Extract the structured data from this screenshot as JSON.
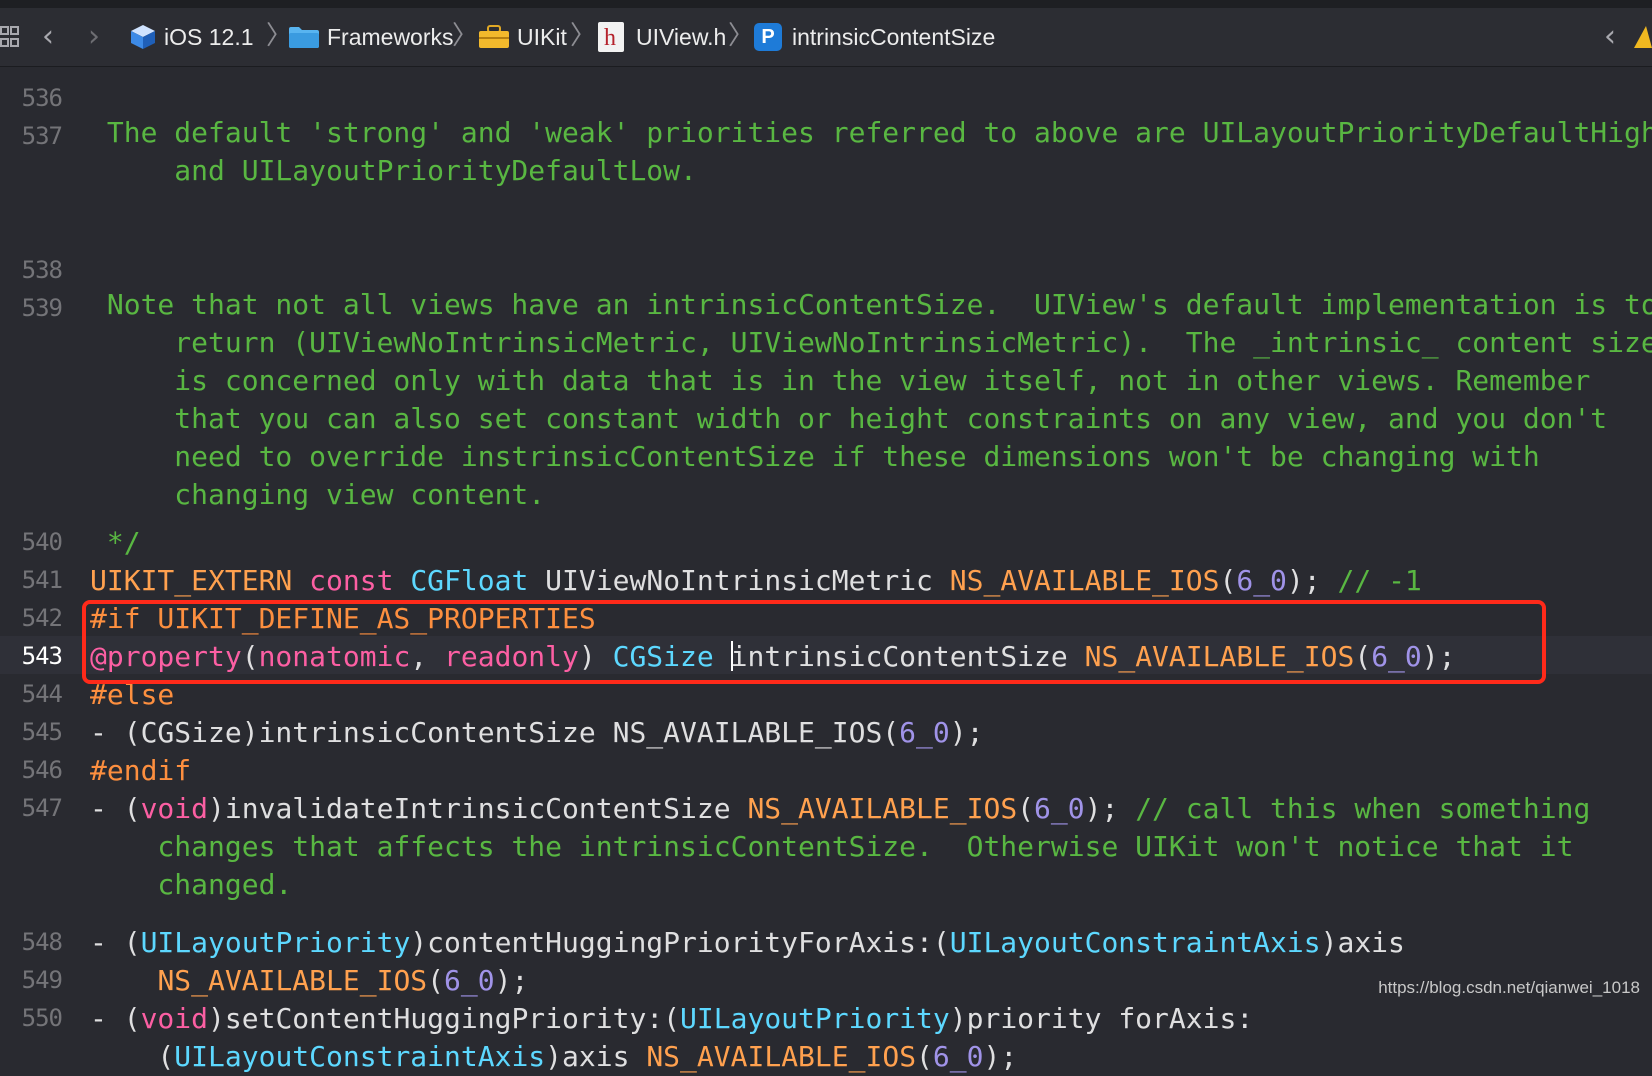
{
  "jumpbar": {
    "grid_icon": "grid-icon",
    "back_icon": "chevron-left-icon",
    "forward_icon": "chevron-right-icon",
    "crumbs": [
      {
        "label": "iOS 12.1",
        "icon": "sdk-icon"
      },
      {
        "label": "Frameworks",
        "icon": "folder-icon"
      },
      {
        "label": "UIKit",
        "icon": "toolbox-icon"
      },
      {
        "label": "UIView.h",
        "icon": "header-file-icon"
      },
      {
        "label": "intrinsicContentSize",
        "icon": "property-icon"
      }
    ],
    "property_badge": "P",
    "header_badge": "h",
    "right_icons": [
      "chevron-left-icon",
      "warning-icon"
    ]
  },
  "editor": {
    "line_numbers": [
      "536",
      "537",
      "538",
      "539",
      "540",
      "541",
      "542",
      "543",
      "544",
      "545",
      "546",
      "547",
      "548",
      "549",
      "550"
    ],
    "current_line": "543",
    "lines": {
      "l537a": " The default 'strong' and 'weak' priorities referred to above are UILayoutPriorityDefaultHigh",
      "l537b": "     and UILayoutPriorityDefaultLow.",
      "l539a": " Note that not all views have an intrinsicContentSize.  UIView's default implementation is to",
      "l539b": "     return (UIViewNoIntrinsicMetric, UIViewNoIntrinsicMetric).  The _intrinsic_ content size",
      "l539c": "     is concerned only with data that is in the view itself, not in other views. Remember",
      "l539d": "     that you can also set constant width or height constraints on any view, and you don't",
      "l539e": "     need to override instrinsicContentSize if these dimensions won't be changing with",
      "l539f": "     changing view content.",
      "l540": " */",
      "l541": {
        "t1": "UIKIT_EXTERN",
        "t2": " ",
        "t3": "const",
        "t4": " ",
        "t5": "CGFloat",
        "t6": " UIViewNoIntrinsicMetric ",
        "t7": "NS_AVAILABLE_IOS",
        "t8": "(",
        "t9": "6_0",
        "t10": "); ",
        "t11": "// -1"
      },
      "l542": "#if UIKIT_DEFINE_AS_PROPERTIES",
      "l543": {
        "t1": "@property",
        "t2": "(",
        "t3": "nonatomic",
        "t4": ", ",
        "t5": "readonly",
        "t6": ") ",
        "t7": "CGSize",
        "t8": " ",
        "t9": "intrinsicContentSize ",
        "t10": "NS_AVAILABLE_IOS",
        "t11": "(",
        "t12": "6_0",
        "t13": ");"
      },
      "l544": "#else",
      "l545": {
        "t1": "- (CGSize)intrinsicContentSize NS_AVAILABLE_IOS(",
        "t2": "6_0",
        "t3": ");"
      },
      "l546": "#endif",
      "l547a": {
        "t1": "- (",
        "t2": "void",
        "t3": ")invalidateIntrinsicContentSize ",
        "t4": "NS_AVAILABLE_IOS",
        "t5": "(",
        "t6": "6_0",
        "t7": "); ",
        "t8": "// call this when something"
      },
      "l547b": "    changes that affects the intrinsicContentSize.  Otherwise UIKit won't notice that it",
      "l547c": "    changed.",
      "l549a": {
        "t1": "- (",
        "t2": "UILayoutPriority",
        "t3": ")contentHuggingPriorityForAxis:(",
        "t4": "UILayoutConstraintAxis",
        "t5": ")axis"
      },
      "l549b": {
        "t1": "    ",
        "t2": "NS_AVAILABLE_IOS",
        "t3": "(",
        "t4": "6_0",
        "t5": ");"
      },
      "l550a": {
        "t1": "- (",
        "t2": "void",
        "t3": ")setContentHuggingPriority:(",
        "t4": "UILayoutPriority",
        "t5": ")priority forAxis:"
      },
      "l550b": {
        "t1": "    (",
        "t2": "UILayoutConstraintAxis",
        "t3": ")axis ",
        "t4": "NS_AVAILABLE_IOS",
        "t5": "(",
        "t6": "6_0",
        "t7": ");"
      }
    }
  },
  "watermark": "https://blog.csdn.net/qianwei_1018",
  "colors": {
    "background": "#292a30",
    "comment": "#59b742",
    "keyword": "#fc5fa3",
    "type": "#5dd8ff",
    "macro": "#ffa14f",
    "number": "#a093e8",
    "highlight_box": "#ff2a1a"
  }
}
